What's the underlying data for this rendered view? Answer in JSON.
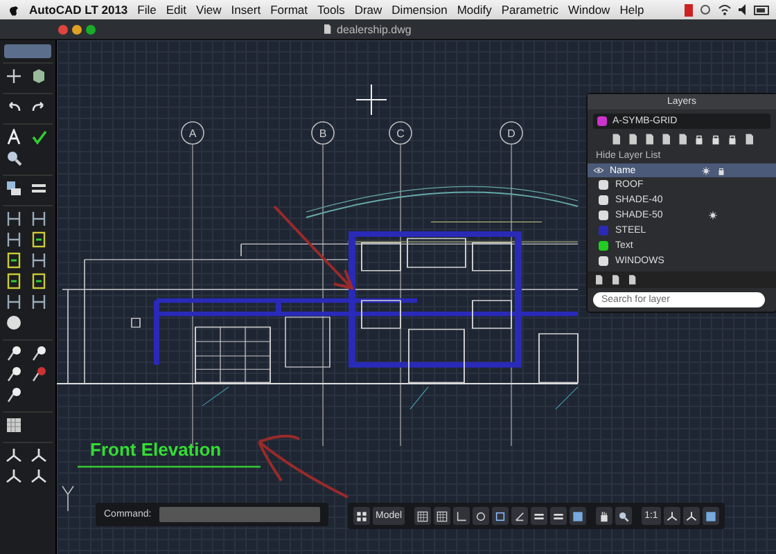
{
  "menu_bar": {
    "app": "AutoCAD LT 2013",
    "items": [
      "File",
      "Edit",
      "View",
      "Insert",
      "Format",
      "Tools",
      "Draw",
      "Dimension",
      "Modify",
      "Parametric",
      "Window",
      "Help"
    ]
  },
  "window": {
    "title": "dealership.dwg"
  },
  "drawing": {
    "grid_labels": [
      "A",
      "B",
      "C",
      "D"
    ],
    "title": "Front Elevation"
  },
  "layers_panel": {
    "title": "Layers",
    "current_layer": {
      "name": "A-SYMB-GRID",
      "color": "#cc33cc"
    },
    "toggle": "Hide Layer List",
    "header": "Name",
    "layers": [
      {
        "name": "ROOF",
        "color": "#dddddd",
        "frozen": false
      },
      {
        "name": "SHADE-40",
        "color": "#dddddd",
        "frozen": false
      },
      {
        "name": "SHADE-50",
        "color": "#dddddd",
        "frozen": true
      },
      {
        "name": "STEEL",
        "color": "#2a2ab8",
        "frozen": false
      },
      {
        "name": "Text",
        "color": "#22cc22",
        "frozen": false
      },
      {
        "name": "WINDOWS",
        "color": "#dddddd",
        "frozen": false
      }
    ],
    "search": {
      "placeholder": "Search for layer"
    }
  },
  "command_line": {
    "label": "Command:"
  },
  "status_bar": {
    "space": "Model",
    "scale": "1:1"
  }
}
